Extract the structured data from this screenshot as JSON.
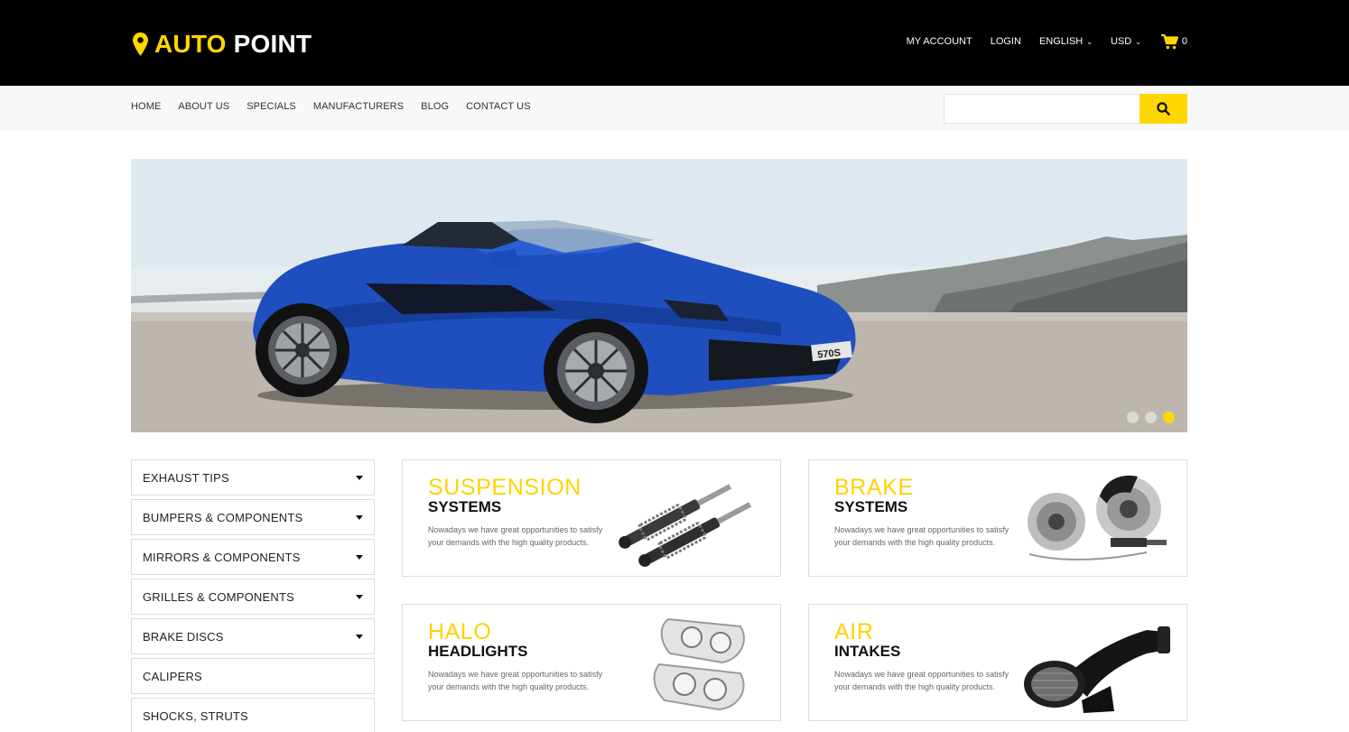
{
  "header": {
    "logo_part1": "AUTO",
    "logo_part2": "POINT",
    "my_account": "MY ACCOUNT",
    "login": "LOGIN",
    "language": "ENGLISH",
    "currency": "USD",
    "cart_count": "0"
  },
  "nav": {
    "items": [
      {
        "label": "HOME"
      },
      {
        "label": "ABOUT US"
      },
      {
        "label": "SPECIALS"
      },
      {
        "label": "MANUFACTURERS"
      },
      {
        "label": "BLOG"
      },
      {
        "label": "CONTACT US"
      }
    ],
    "search_placeholder": ""
  },
  "hero": {
    "plate_text": "570S",
    "slide_count": 3,
    "active_slide": 3
  },
  "categories": [
    {
      "label": "EXHAUST TIPS",
      "has_submenu": true
    },
    {
      "label": "BUMPERS & COMPONENTS",
      "has_submenu": true
    },
    {
      "label": "MIRRORS & COMPONENTS",
      "has_submenu": true
    },
    {
      "label": "GRILLES & COMPONENTS",
      "has_submenu": true
    },
    {
      "label": "BRAKE DISCS",
      "has_submenu": true
    },
    {
      "label": "CALIPERS",
      "has_submenu": false
    },
    {
      "label": "SHOCKS, STRUTS",
      "has_submenu": false
    }
  ],
  "promos": [
    {
      "title_light": "SUSPENSION",
      "title_bold": "SYSTEMS",
      "description": "Nowadays we have great opportunities to satisfy your demands with the high quality products.",
      "icon": "suspension-coilover-image"
    },
    {
      "title_light": "BRAKE",
      "title_bold": "SYSTEMS",
      "description": "Nowadays we have great opportunities to satisfy your demands with the high quality products.",
      "icon": "brake-kit-image"
    },
    {
      "title_light": "HALO",
      "title_bold": "HEADLIGHTS",
      "description": "Nowadays we have great opportunities to satisfy your demands with the high quality products.",
      "icon": "headlights-image"
    },
    {
      "title_light": "AIR",
      "title_bold": "INTAKES",
      "description": "Nowadays we have great opportunities to satisfy your demands with the high quality products.",
      "icon": "air-intake-image"
    }
  ],
  "colors": {
    "accent": "#ffd700",
    "header_bg": "#000000",
    "nav_bg": "#f8f8f8",
    "car_blue": "#1f4fbf"
  }
}
